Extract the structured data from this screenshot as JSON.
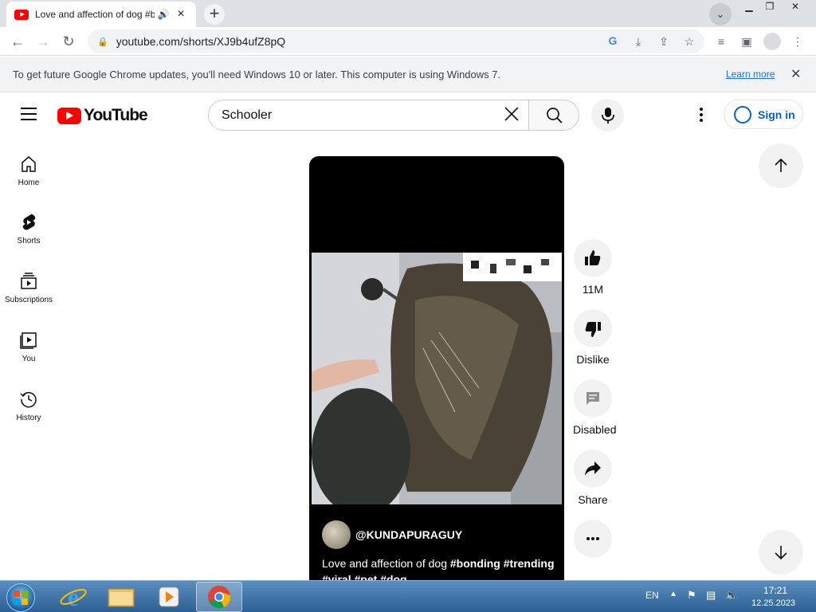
{
  "browser": {
    "tab_title": "Love and affection of dog #b",
    "tab_audio_icon": "speaker-icon",
    "tab_close": "×",
    "new_tab": "+",
    "url": "youtube.com/shorts/XJ9b4ufZ8pQ",
    "infobar_text": "To get future Google Chrome updates, you'll need Windows 10 or later. This computer is using Windows 7.",
    "infobar_link": "Learn more"
  },
  "youtube": {
    "logo_text": "YouTube",
    "search_value": "Schooler",
    "sign_in": "Sign in",
    "sidebar": [
      {
        "label": "Home",
        "icon": "home-icon"
      },
      {
        "label": "Shorts",
        "icon": "shorts-icon"
      },
      {
        "label": "Subscriptions",
        "icon": "subscriptions-icon"
      },
      {
        "label": "You",
        "icon": "you-icon"
      },
      {
        "label": "History",
        "icon": "history-icon"
      }
    ],
    "short": {
      "channel": "@KUNDAPURAGUY",
      "caption_plain": "Love and affection of dog ",
      "caption_tags_1": "#bonding #trending",
      "caption_tags_2": "#viral #pet #dog"
    },
    "actions": {
      "like_count": "11M",
      "dislike": "Dislike",
      "comments": "Disabled",
      "share": "Share"
    }
  },
  "taskbar": {
    "lang": "EN",
    "time": "17:21",
    "date": "12.25.2023"
  }
}
